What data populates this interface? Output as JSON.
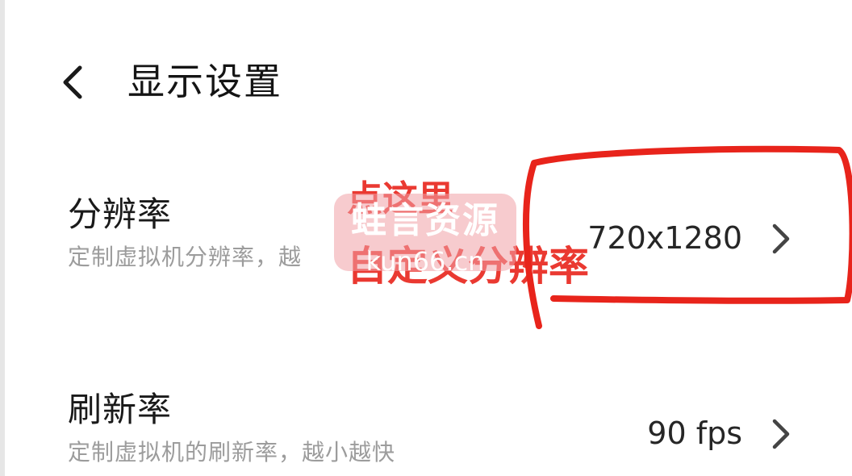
{
  "header": {
    "back_icon": "chevron-left-icon",
    "title": "显示设置"
  },
  "settings": [
    {
      "title": "分辨率",
      "description": "定制虚拟机分辨率，越",
      "value": "720x1280",
      "icon": "chevron-right-icon"
    },
    {
      "title": "刷新率",
      "description": "定制虚拟机的刷新率，越小越快",
      "value": "90 fps",
      "icon": "chevron-right-icon"
    }
  ],
  "annotation": {
    "line1": "点这里",
    "line2": "自定义分辨率",
    "color": "#e8241b"
  },
  "watermark": {
    "main": "蛙言资源",
    "sub": "kun66.cn",
    "color": "#f0a0a5"
  }
}
